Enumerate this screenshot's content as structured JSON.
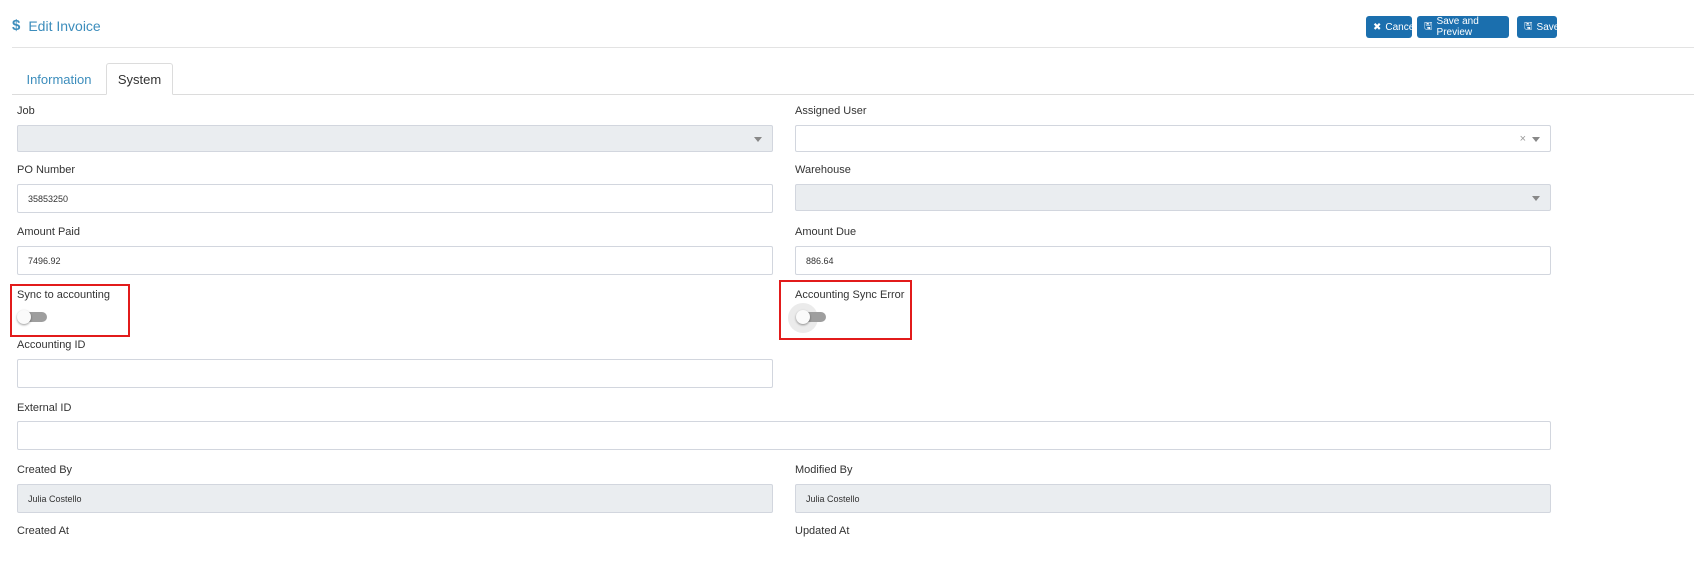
{
  "header": {
    "title": "Edit Invoice",
    "buttons": {
      "cancel": "Cancel",
      "save_preview": "Save and Preview",
      "save": "Save"
    }
  },
  "tabs": [
    {
      "label": "Information",
      "active": false
    },
    {
      "label": "System",
      "active": true
    }
  ],
  "form": {
    "job": {
      "label": "Job",
      "value": ""
    },
    "assigned_user": {
      "label": "Assigned User",
      "value": ""
    },
    "po_number": {
      "label": "PO Number",
      "value": "35853250"
    },
    "warehouse": {
      "label": "Warehouse",
      "value": ""
    },
    "amount_paid": {
      "label": "Amount Paid",
      "value": "7496.92"
    },
    "amount_due": {
      "label": "Amount Due",
      "value": "886.64"
    },
    "sync_to_accounting": {
      "label": "Sync to accounting",
      "checked": false
    },
    "accounting_sync_error": {
      "label": "Accounting Sync Error",
      "checked": false
    },
    "accounting_id": {
      "label": "Accounting ID",
      "value": ""
    },
    "external_id": {
      "label": "External ID",
      "value": ""
    },
    "created_by": {
      "label": "Created By",
      "value": "Julia Costello"
    },
    "modified_by": {
      "label": "Modified By",
      "value": "Julia Costello"
    },
    "created_at": {
      "label": "Created At"
    },
    "updated_at": {
      "label": "Updated At"
    }
  },
  "colors": {
    "accent": "#3c8dbc",
    "button": "#1b6fae",
    "highlight": "#e21b1b"
  }
}
